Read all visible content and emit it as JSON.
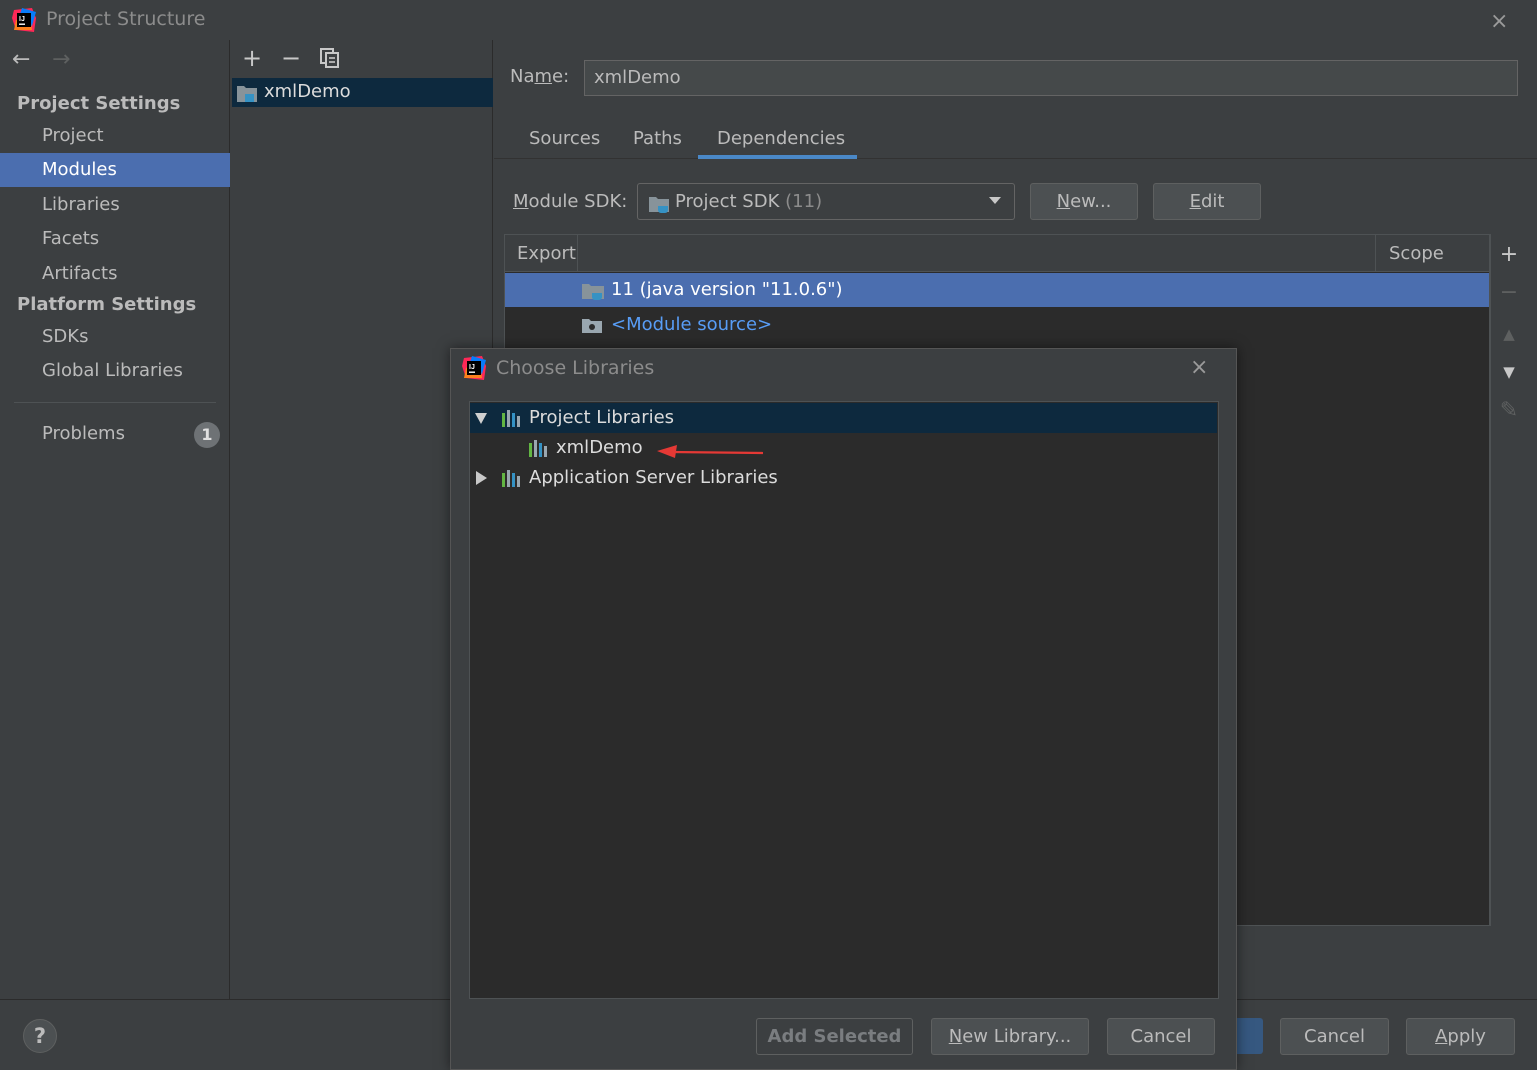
{
  "window": {
    "title": "Project Structure",
    "close_icon": "×"
  },
  "nav": {
    "back_icon": "←",
    "forward_icon": "→"
  },
  "sidebar": {
    "project_settings_header": "Project Settings",
    "project_items": [
      {
        "label": "Project",
        "selected": false
      },
      {
        "label": "Modules",
        "selected": true
      },
      {
        "label": "Libraries",
        "selected": false
      },
      {
        "label": "Facets",
        "selected": false
      },
      {
        "label": "Artifacts",
        "selected": false
      }
    ],
    "platform_settings_header": "Platform Settings",
    "platform_items": [
      {
        "label": "SDKs"
      },
      {
        "label": "Global Libraries"
      }
    ],
    "problems": {
      "label": "Problems",
      "count": "1"
    }
  },
  "modules": {
    "toolbar": {
      "add": "+",
      "remove": "−",
      "copy": "⧉"
    },
    "items": [
      {
        "label": "xmlDemo"
      }
    ]
  },
  "module_detail": {
    "name_label": "Name:",
    "name_value": "xmlDemo",
    "tabs": [
      {
        "label": "Sources",
        "active": false
      },
      {
        "label": "Paths",
        "active": false
      },
      {
        "label": "Dependencies",
        "active": true
      }
    ],
    "sdk_label": "Module SDK:",
    "sdk_value": "Project SDK",
    "sdk_version": "(11)",
    "new_button": "New...",
    "edit_button": "Edit",
    "table": {
      "col_export": "Export",
      "col_scope": "Scope",
      "rows": [
        {
          "label": "11 (java version \"11.0.6\")",
          "selected": true
        },
        {
          "label": "<Module source>",
          "selected": false
        }
      ]
    },
    "side_toolbar": {
      "add": "+",
      "remove": "−",
      "up": "▲",
      "down": "▼",
      "edit": "✎"
    }
  },
  "bottom": {
    "help": "?",
    "cancel": "Cancel",
    "apply": "Apply"
  },
  "choose_libraries": {
    "title": "Choose Libraries",
    "close_icon": "×",
    "tree": {
      "project_libraries": "Project Libraries",
      "project_library_items": [
        "xmlDemo"
      ],
      "app_server_libraries": "Application Server Libraries"
    },
    "buttons": {
      "add_selected": "Add Selected",
      "new_library": "New Library...",
      "cancel": "Cancel"
    }
  },
  "colors": {
    "background": "#3c3f41",
    "selection": "#4b6eaf",
    "tree_selection": "#0d293e",
    "link": "#589df6",
    "annotation_arrow": "#e53935"
  }
}
